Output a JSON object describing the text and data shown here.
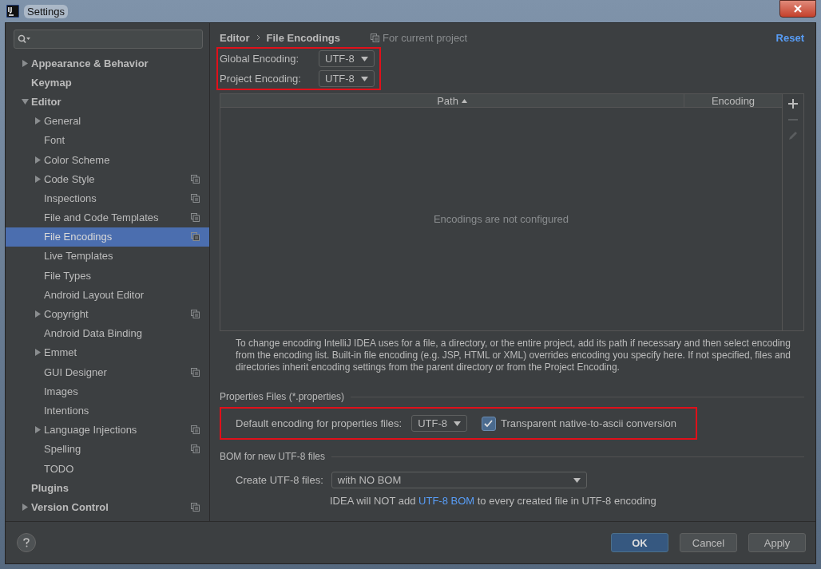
{
  "window": {
    "title": "Settings"
  },
  "sidebar": {
    "items": [
      {
        "label": "Appearance & Behavior",
        "expandable": true,
        "expanded": false,
        "selected": false,
        "project_scope": false
      },
      {
        "label": "Keymap",
        "expandable": false,
        "expanded": false,
        "selected": false,
        "project_scope": false
      },
      {
        "label": "Editor",
        "expandable": true,
        "expanded": true,
        "selected": false,
        "project_scope": false,
        "children": [
          {
            "label": "General",
            "expandable": true,
            "expanded": false,
            "selected": false,
            "project_scope": false
          },
          {
            "label": "Font",
            "expandable": false,
            "expanded": false,
            "selected": false,
            "project_scope": false
          },
          {
            "label": "Color Scheme",
            "expandable": true,
            "expanded": false,
            "selected": false,
            "project_scope": false
          },
          {
            "label": "Code Style",
            "expandable": true,
            "expanded": false,
            "selected": false,
            "project_scope": true
          },
          {
            "label": "Inspections",
            "expandable": false,
            "expanded": false,
            "selected": false,
            "project_scope": true
          },
          {
            "label": "File and Code Templates",
            "expandable": false,
            "expanded": false,
            "selected": false,
            "project_scope": true
          },
          {
            "label": "File Encodings",
            "expandable": false,
            "expanded": false,
            "selected": true,
            "project_scope": true
          },
          {
            "label": "Live Templates",
            "expandable": false,
            "expanded": false,
            "selected": false,
            "project_scope": false
          },
          {
            "label": "File Types",
            "expandable": false,
            "expanded": false,
            "selected": false,
            "project_scope": false
          },
          {
            "label": "Android Layout Editor",
            "expandable": false,
            "expanded": false,
            "selected": false,
            "project_scope": false
          },
          {
            "label": "Copyright",
            "expandable": true,
            "expanded": false,
            "selected": false,
            "project_scope": true
          },
          {
            "label": "Android Data Binding",
            "expandable": false,
            "expanded": false,
            "selected": false,
            "project_scope": false
          },
          {
            "label": "Emmet",
            "expandable": true,
            "expanded": false,
            "selected": false,
            "project_scope": false
          },
          {
            "label": "GUI Designer",
            "expandable": false,
            "expanded": false,
            "selected": false,
            "project_scope": true
          },
          {
            "label": "Images",
            "expandable": false,
            "expanded": false,
            "selected": false,
            "project_scope": false
          },
          {
            "label": "Intentions",
            "expandable": false,
            "expanded": false,
            "selected": false,
            "project_scope": false
          },
          {
            "label": "Language Injections",
            "expandable": true,
            "expanded": false,
            "selected": false,
            "project_scope": true
          },
          {
            "label": "Spelling",
            "expandable": false,
            "expanded": false,
            "selected": false,
            "project_scope": true
          },
          {
            "label": "TODO",
            "expandable": false,
            "expanded": false,
            "selected": false,
            "project_scope": false
          }
        ]
      },
      {
        "label": "Plugins",
        "expandable": false,
        "expanded": false,
        "selected": false,
        "project_scope": false
      },
      {
        "label": "Version Control",
        "expandable": true,
        "expanded": false,
        "selected": false,
        "project_scope": true
      }
    ]
  },
  "header": {
    "breadcrumb": [
      "Editor",
      "File Encodings"
    ],
    "scope": "For current project",
    "reset": "Reset"
  },
  "encodings": [
    {
      "label": "Global Encoding:",
      "value": "UTF-8"
    },
    {
      "label": "Project Encoding:",
      "value": "UTF-8"
    }
  ],
  "table": {
    "columns": [
      {
        "label": "Path",
        "sorted": true
      },
      {
        "label": "Encoding",
        "sorted": false
      }
    ],
    "empty_text": "Encodings are not configured",
    "tools": [
      {
        "kind": "add",
        "disabled": false
      },
      {
        "kind": "remove",
        "disabled": true
      },
      {
        "kind": "edit",
        "disabled": true
      }
    ]
  },
  "description": "To change encoding IntelliJ IDEA uses for a file, a directory, or the entire project, add its path if necessary and then select encoding from the encoding list. Built-in file encoding (e.g. JSP, HTML or XML) overrides encoding you specify here. If not specified, files and directories inherit encoding settings from the parent directory or from the Project Encoding.",
  "properties": {
    "title": "Properties Files (*.properties)",
    "label": "Default encoding for properties files:",
    "value": "UTF-8",
    "checkbox": {
      "label": "Transparent native-to-ascii conversion",
      "checked": true
    }
  },
  "bom": {
    "title": "BOM for new UTF-8 files",
    "label": "Create UTF-8 files:",
    "value": "with NO BOM",
    "info_before": "IDEA will NOT add",
    "info_link": "UTF-8 BOM",
    "info_after": "to every created file in UTF-8 encoding"
  },
  "buttons": [
    {
      "label": "OK",
      "kind": "primary"
    },
    {
      "label": "Cancel",
      "kind": "normal"
    },
    {
      "label": "Apply",
      "kind": "normal"
    }
  ]
}
